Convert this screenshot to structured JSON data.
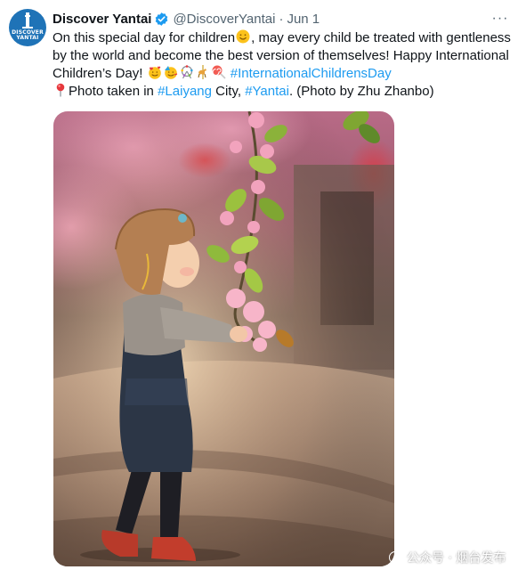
{
  "author": {
    "display_name": "Discover Yantai",
    "handle": "@DiscoverYantai",
    "separator": "·",
    "date": "Jun 1",
    "avatar_text": "DISCOVER YANTAI",
    "verified_color": "#1d9bf0"
  },
  "more_label": "···",
  "body": {
    "line1_a": "On this special day for children",
    "line1_b": ", may every child be treated with gentleness by the world and become the best version of themselves! Happy International Children’s Day!",
    "hashtag_day": "#InternationalChildrensDay",
    "line2_a": "Photo taken in ",
    "hashtag_laiyang": "#Laiyang",
    "line2_b": " City, ",
    "hashtag_yantai": "#Yantai",
    "line2_c": ". (Photo by Zhu Zhanbo)"
  },
  "emojis": [
    "smiling-face-icon",
    "face-with-hearts-icon",
    "partying-face-icon",
    "ferris-wheel-icon",
    "carousel-horse-icon",
    "lollipop-icon",
    "round-pushpin-icon"
  ],
  "photo": {
    "description_icon": "photo-child-with-blossoms"
  },
  "watermark": {
    "text": "公众号 · 烟台发布"
  },
  "colors": {
    "link": "#1d9bf0",
    "secondary": "#536471",
    "primary": "#0f1419",
    "avatar_bg": "#1f73b7"
  }
}
